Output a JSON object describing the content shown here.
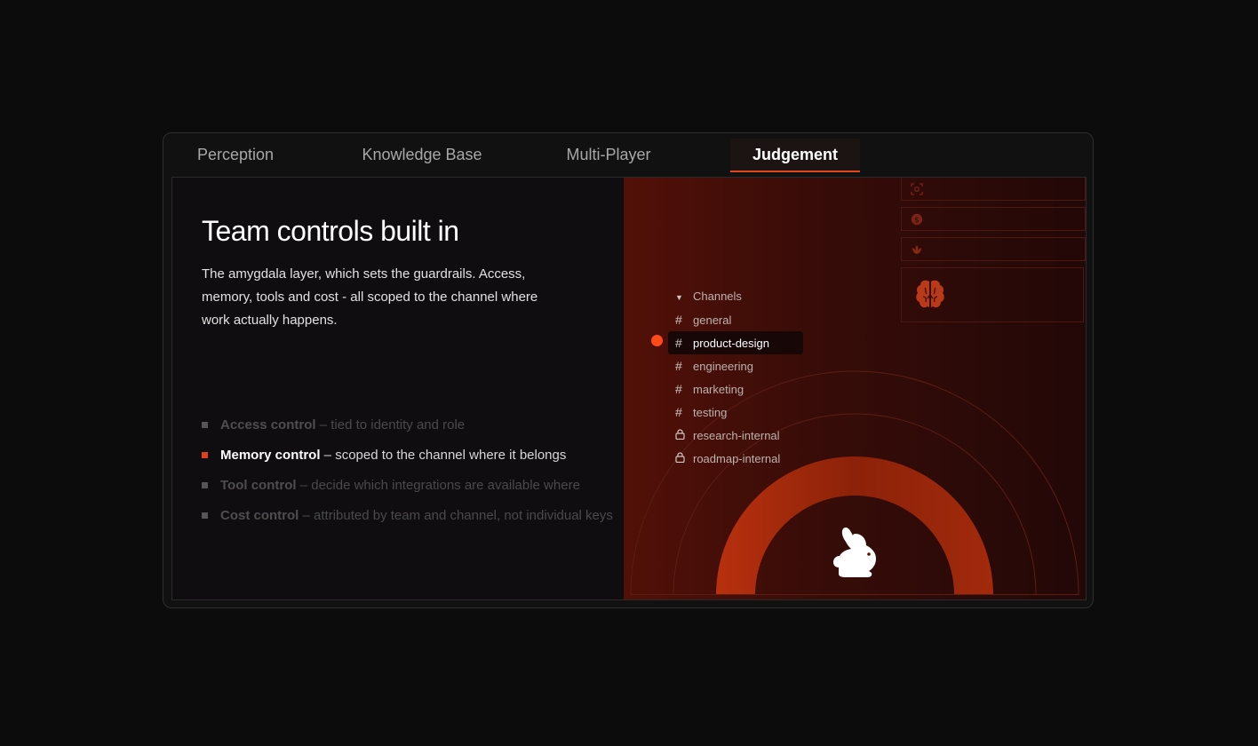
{
  "tabs": [
    {
      "label": "Perception"
    },
    {
      "label": "Knowledge Base"
    },
    {
      "label": "Multi-Player"
    },
    {
      "label": "Judgement",
      "active": true
    }
  ],
  "left": {
    "title": "Team controls built in",
    "description": "The amygdala layer, which sets the guardrails. Access, memory, tools and cost - all scoped to the channel where work actually happens.",
    "features": [
      {
        "name": "Access control",
        "rest": " – tied to identity and role",
        "active": false
      },
      {
        "name": "Memory control",
        "rest": " – scoped to the channel where it belongs",
        "active": true
      },
      {
        "name": "Tool control",
        "rest": " – decide which integrations are available where",
        "active": false
      },
      {
        "name": "Cost control",
        "rest": " – attributed by team and channel, not individual keys",
        "active": false
      }
    ]
  },
  "right": {
    "channels_header": "Channels",
    "channels": [
      {
        "name": "general",
        "type": "public"
      },
      {
        "name": "product-design",
        "type": "public",
        "selected": true
      },
      {
        "name": "engineering",
        "type": "public"
      },
      {
        "name": "marketing",
        "type": "public"
      },
      {
        "name": "testing",
        "type": "public"
      },
      {
        "name": "research-internal",
        "type": "private"
      },
      {
        "name": "roadmap-internal",
        "type": "private"
      }
    ],
    "side_icons": [
      "face-scan-icon",
      "dollar-icon",
      "lotus-icon",
      "brain-icon"
    ],
    "center_icon": "rabbit-icon"
  },
  "colors": {
    "accent": "#e0401a",
    "background": "#0c0c0c",
    "panel_gradient_start": "#521008",
    "panel_gradient_end": "#220807"
  }
}
